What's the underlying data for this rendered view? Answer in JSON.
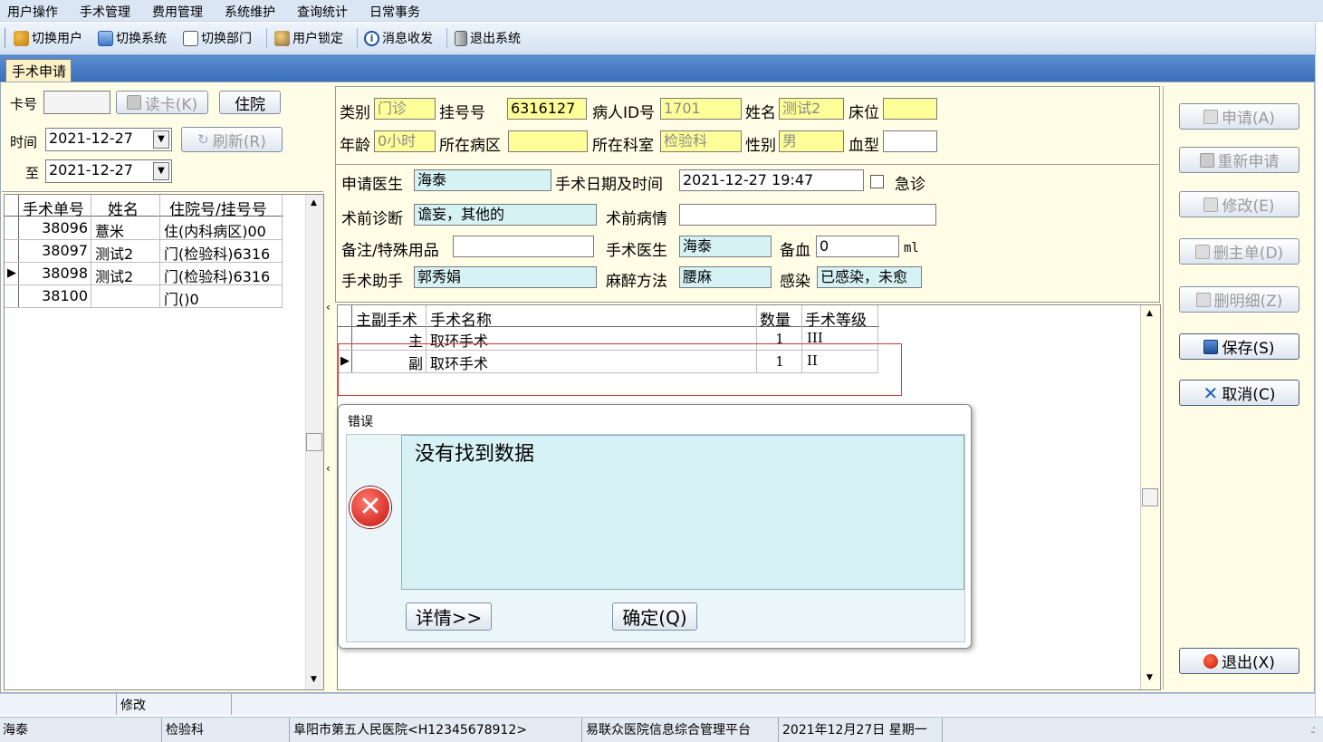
{
  "menu": [
    "用户操作",
    "手术管理",
    "费用管理",
    "系统维护",
    "查询统计",
    "日常事务"
  ],
  "toolbar": {
    "switch_user": "切换用户",
    "switch_system": "切换系统",
    "switch_dept": "切换部门",
    "lock_user": "用户锁定",
    "messages": "消息收发",
    "exit_system": "退出系统"
  },
  "tab": {
    "label": "手术申请"
  },
  "search": {
    "card_label": "卡号",
    "card_value": "",
    "read_card": "读卡(K)",
    "inpatient": "住院",
    "time_label": "时间",
    "date_from": "2021-12-27",
    "refresh": "刷新(R)",
    "to_label": "至",
    "date_to": "2021-12-27"
  },
  "list": {
    "headers": [
      "手术单号",
      "姓名",
      "住院号/挂号号"
    ],
    "rows": [
      {
        "id": "38096",
        "name": "薏米",
        "reg": "住(内科病区)00"
      },
      {
        "id": "38097",
        "name": "测试2",
        "reg": "门(检验科)6316"
      },
      {
        "id": "38098",
        "name": "测试2",
        "reg": "门(检验科)6316"
      },
      {
        "id": "38100",
        "name": "",
        "reg": "门()0"
      }
    ]
  },
  "patient": {
    "type_label": "类别",
    "type": "门诊",
    "reg_label": "挂号号",
    "reg": "6316127",
    "pid_label": "病人ID号",
    "pid": "1701",
    "name_label": "姓名",
    "name": "测试2",
    "bed_label": "床位",
    "bed": "",
    "age_label": "年龄",
    "age": "0小时",
    "ward_label": "所在病区",
    "ward": "",
    "dept_label": "所在科室",
    "dept": "检验科",
    "gender_label": "性别",
    "gender": "男",
    "blood_label": "血型",
    "blood": ""
  },
  "apply": {
    "doctor_label": "申请医生",
    "doctor": "海泰",
    "datetime_label": "手术日期及时间",
    "datetime": "2021-12-27 19:47",
    "emergency_label": "急诊",
    "diag_label": "术前诊断",
    "diag": "谵妄，其他的",
    "cond_label": "术前病情",
    "cond": "",
    "note_label": "备注/特殊用品",
    "note": "",
    "surgeon_label": "手术医生",
    "surgeon": "海泰",
    "blood_prep_label": "备血",
    "blood_prep": "0",
    "blood_unit": "ml",
    "assistant_label": "手术助手",
    "assistant": "郭秀娟",
    "anesthesia_label": "麻醉方法",
    "anesthesia": "腰麻",
    "infection_label": "感染",
    "infection": "已感染，未愈"
  },
  "ops": {
    "headers": [
      "主副手术",
      "手术名称",
      "数量",
      "手术等级"
    ],
    "rows": [
      {
        "type": "主",
        "name": "取环手术",
        "qty": "1",
        "level": "III"
      },
      {
        "type": "副",
        "name": "取环手术",
        "qty": "1",
        "level": "II"
      }
    ]
  },
  "dialog": {
    "title": "错误",
    "message": "没有找到数据",
    "details": "详情>>",
    "ok": "确定(Q)"
  },
  "actions": {
    "apply": "申请(A)",
    "reapply": "重新申请",
    "modify": "修改(E)",
    "delete_main": "删主单(D)",
    "delete_detail": "删明细(Z)",
    "save": "保存(S)",
    "cancel": "取消(C)",
    "exit": "退出(X)"
  },
  "status1": {
    "mode": "修改"
  },
  "status2": {
    "user": "海泰",
    "dept": "检验科",
    "hospital": "阜阳市第五人民医院<H12345678912>",
    "platform": "易联众医院信息综合管理平台",
    "date": "2021年12月27日 星期一"
  }
}
